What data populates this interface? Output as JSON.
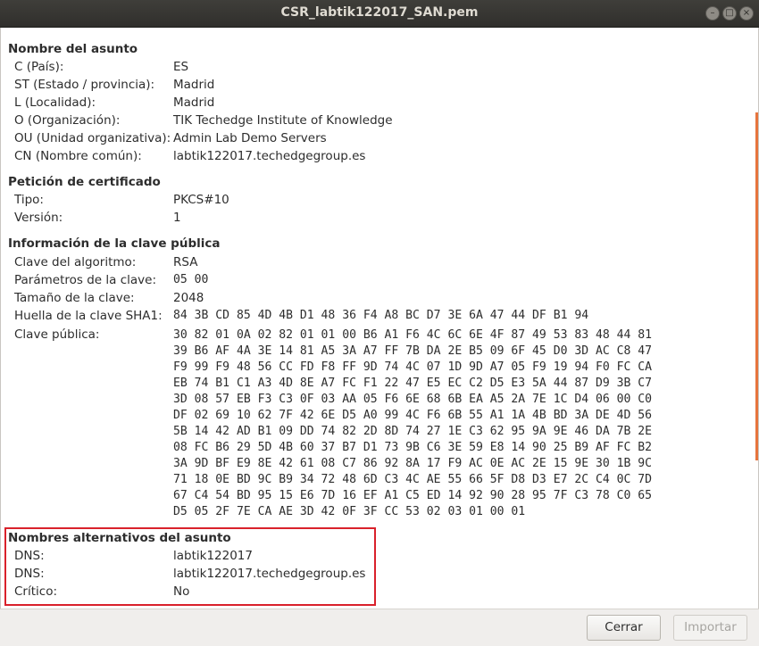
{
  "window": {
    "title": "CSR_labtik122017_SAN.pem",
    "controls": {
      "minimize": "–",
      "maximize": "□",
      "close": "×"
    }
  },
  "subject": {
    "heading": "Nombre del asunto",
    "rows": [
      {
        "label": "C (País):",
        "value": "ES"
      },
      {
        "label": "ST (Estado / provincia):",
        "value": "Madrid"
      },
      {
        "label": "L (Localidad):",
        "value": "Madrid"
      },
      {
        "label": "O (Organización):",
        "value": "TIK Techedge Institute of Knowledge"
      },
      {
        "label": "OU (Unidad organizativa):",
        "value": "Admin Lab Demo Servers"
      },
      {
        "label": "CN (Nombre común):",
        "value": "labtik122017.techedgegroup.es"
      }
    ]
  },
  "request": {
    "heading": "Petición de certificado",
    "rows": [
      {
        "label": "Tipo:",
        "value": "PKCS#10"
      },
      {
        "label": "Versión:",
        "value": "1"
      }
    ]
  },
  "pubkey": {
    "heading": "Información de la clave pública",
    "rows": [
      {
        "label": "Clave del algoritmo:",
        "value": "RSA"
      },
      {
        "label": "Parámetros de la clave:",
        "value": "05 00"
      },
      {
        "label": "Tamaño de la clave:",
        "value": "2048"
      },
      {
        "label": "Huella de la clave SHA1:",
        "value": "84 3B CD 85 4D 4B D1 48 36 F4 A8 BC D7 3E 6A 47 44 DF B1 94"
      }
    ],
    "public_key_label": "Clave pública:",
    "public_key_lines": [
      "30 82 01 0A 02 82 01 01 00 B6 A1 F6 4C 6C 6E 4F 87 49 53 83 48 44 81",
      "39 B6 AF 4A 3E 14 81 A5 3A A7 FF 7B DA 2E B5 09 6F 45 D0 3D AC C8 47",
      "F9 99 F9 48 56 CC FD F8 FF 9D 74 4C 07 1D 9D A7 05 F9 19 94 F0 FC CA",
      "EB 74 B1 C1 A3 4D 8E A7 FC F1 22 47 E5 EC C2 D5 E3 5A 44 87 D9 3B C7",
      "3D 08 57 EB F3 C3 0F 03 AA 05 F6 6E 68 6B EA A5 2A 7E 1C D4 06 00 C0",
      "DF 02 69 10 62 7F 42 6E D5 A0 99 4C F6 6B 55 A1 1A 4B BD 3A DE 4D 56",
      "5B 14 42 AD B1 09 DD 74 82 2D 8D 74 27 1E C3 62 95 9A 9E 46 DA 7B 2E",
      "08 FC B6 29 5D 4B 60 37 B7 D1 73 9B C6 3E 59 E8 14 90 25 B9 AF FC B2",
      "3A 9D BF E9 8E 42 61 08 C7 86 92 8A 17 F9 AC 0E AC 2E 15 9E 30 1B 9C",
      "71 18 0E BD 9C B9 34 72 48 6D C3 4C AE 55 66 5F D8 D3 E7 2C C4 0C 7D",
      "67 C4 54 BD 95 15 E6 7D 16 EF A1 C5 ED 14 92 90 28 95 7F C3 78 C0 65",
      "D5 05 2F 7E CA AE 3D 42 0F 3F CC 53 02 03 01 00 01"
    ]
  },
  "san": {
    "heading": "Nombres alternativos del asunto",
    "rows": [
      {
        "label": "DNS:",
        "value": "labtik122017"
      },
      {
        "label": "DNS:",
        "value": "labtik122017.techedgegroup.es"
      },
      {
        "label": "Crítico:",
        "value": "No"
      }
    ]
  },
  "buttons": {
    "close": "Cerrar",
    "import": "Importar"
  },
  "colors": {
    "highlight_border": "#d9212b",
    "scroll_accent": "#e6743d"
  }
}
